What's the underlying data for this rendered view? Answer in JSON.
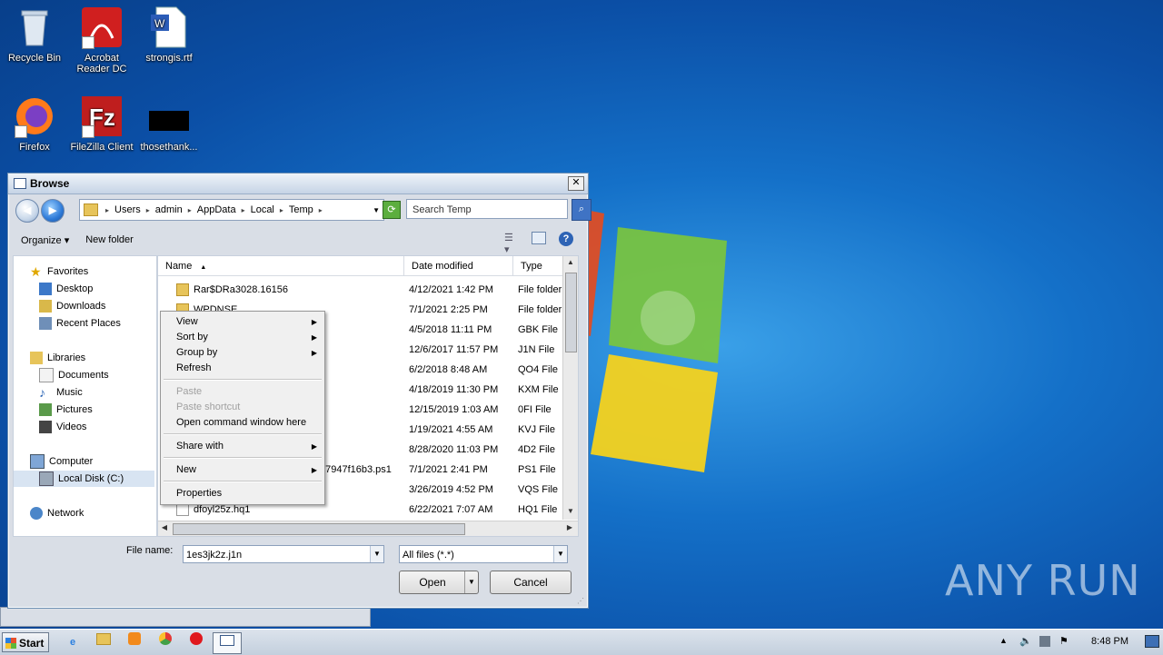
{
  "desktop": {
    "icons": [
      {
        "label": "Recycle Bin",
        "icon": "recycle-bin-icon"
      },
      {
        "label": "Acrobat Reader DC",
        "icon": "acrobat-icon"
      },
      {
        "label": "strongis.rtf",
        "icon": "word-doc-icon"
      },
      {
        "label": "Firefox",
        "icon": "firefox-icon"
      },
      {
        "label": "FileZilla Client",
        "icon": "filezilla-icon"
      },
      {
        "label": "thosethank...",
        "icon": "black-file-icon"
      }
    ],
    "watermark": "ANY RUN"
  },
  "dialog": {
    "title": "Browse",
    "close": "✕",
    "breadcrumb": [
      "Users",
      "admin",
      "AppData",
      "Local",
      "Temp"
    ],
    "search_placeholder": "Search Temp",
    "toolbar": {
      "organize": "Organize ▾",
      "new_folder": "New folder"
    },
    "nav": {
      "favorites": "Favorites",
      "desktop": "Desktop",
      "downloads": "Downloads",
      "recent": "Recent Places",
      "libraries": "Libraries",
      "documents": "Documents",
      "music": "Music",
      "pictures": "Pictures",
      "videos": "Videos",
      "computer": "Computer",
      "local_disk": "Local Disk (C:)",
      "network": "Network"
    },
    "columns": {
      "name": "Name",
      "date": "Date modified",
      "type": "Type"
    },
    "files": [
      {
        "name": "Rar$DRa3028.16156",
        "date": "4/12/2021 1:42 PM",
        "type": "File folder",
        "kind": "folder"
      },
      {
        "name": "WPDNSE",
        "date": "7/1/2021 2:25 PM",
        "type": "File folder",
        "kind": "folder"
      },
      {
        "name": "",
        "date": "4/5/2018 11:11 PM",
        "type": "GBK File",
        "kind": "file"
      },
      {
        "name": "",
        "date": "12/6/2017 11:57 PM",
        "type": "J1N File",
        "kind": "file"
      },
      {
        "name": "",
        "date": "6/2/2018 8:48 AM",
        "type": "QO4 File",
        "kind": "file"
      },
      {
        "name": "",
        "date": "4/18/2019 11:30 PM",
        "type": "KXM File",
        "kind": "file"
      },
      {
        "name": "",
        "date": "12/15/2019 1:03 AM",
        "type": "0FI File",
        "kind": "file"
      },
      {
        "name": "",
        "date": "1/19/2021 4:55 AM",
        "type": "KVJ File",
        "kind": "file"
      },
      {
        "name": "",
        "date": "8/28/2020 11:03 PM",
        "type": "4D2 File",
        "kind": "file"
      },
      {
        "name": "27947f16b3.ps1",
        "date": "7/1/2021 2:41 PM",
        "type": "PS1 File",
        "kind": "file"
      },
      {
        "name": "",
        "date": "3/26/2019 4:52 PM",
        "type": "VQS File",
        "kind": "file"
      },
      {
        "name": "dfoyl25z.hq1",
        "date": "6/22/2021 7:07 AM",
        "type": "HQ1 File",
        "kind": "file"
      }
    ],
    "file_name_label": "File name:",
    "file_name_value": "1es3jk2z.j1n",
    "filter_value": "All files (*.*)",
    "open_label": "Open",
    "cancel_label": "Cancel"
  },
  "context_menu": {
    "view": "View",
    "sort_by": "Sort by",
    "group_by": "Group by",
    "refresh": "Refresh",
    "paste": "Paste",
    "paste_shortcut": "Paste shortcut",
    "open_cmd": "Open command window here",
    "share_with": "Share with",
    "new": "New",
    "properties": "Properties"
  },
  "taskbar": {
    "start": "Start",
    "clock": "8:48 PM"
  }
}
